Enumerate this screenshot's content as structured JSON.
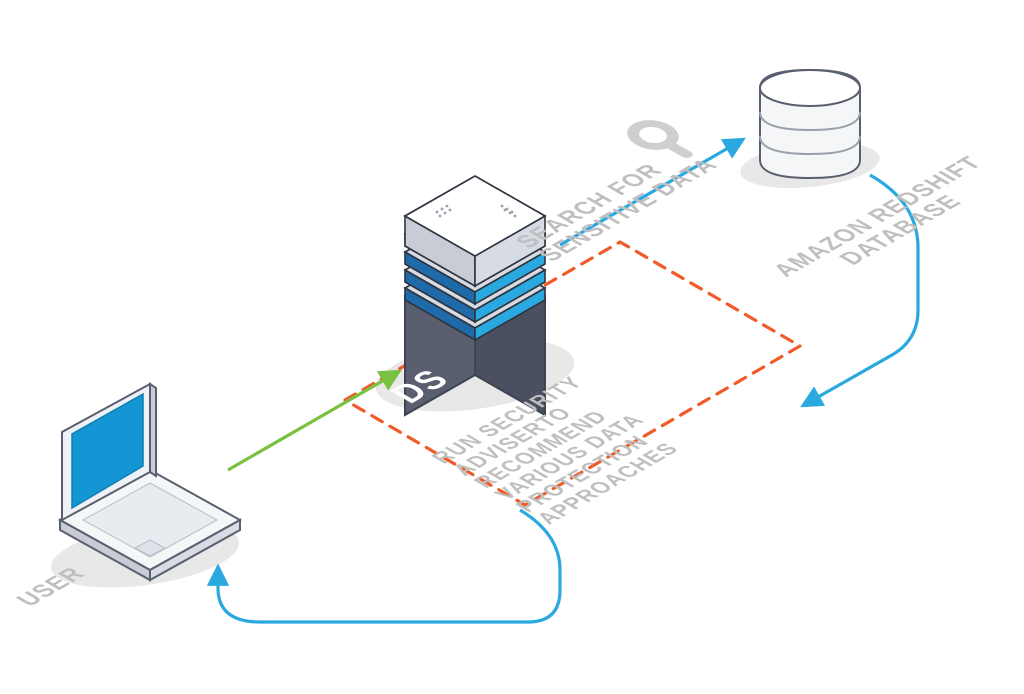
{
  "diagram": {
    "user_label": "USER",
    "server_badge": "DS",
    "search_label": "SEARCH FOR\nSENSITIVE DATA",
    "db_label": "AMAZON REDSHIFT\nDATABASE",
    "advice_label": "RUN SECURITY\nADVISERTO\nRECOMMEND\nVARIOUS DATA\nPROTECTION\nAPPROACHES",
    "nodes": [
      {
        "id": "user",
        "type": "laptop"
      },
      {
        "id": "ds_server",
        "type": "server"
      },
      {
        "id": "redshift",
        "type": "database"
      }
    ],
    "arrows": [
      {
        "from": "user",
        "to": "ds_server",
        "color": "green"
      },
      {
        "from": "ds_server",
        "to": "redshift",
        "color": "blue",
        "label_ref": "search_label"
      },
      {
        "from": "redshift",
        "to": "advice_box",
        "color": "blue"
      },
      {
        "from": "advice_box",
        "to": "user",
        "color": "blue"
      }
    ],
    "colors": {
      "green": "#7ac142",
      "blue": "#2aa8e0",
      "orange_dash": "#f15a29",
      "grey": "#bfbfbf",
      "server_dark": "#5a5f70",
      "server_light": "#d7dbe3",
      "laptop_screen": "#1396d3"
    }
  }
}
